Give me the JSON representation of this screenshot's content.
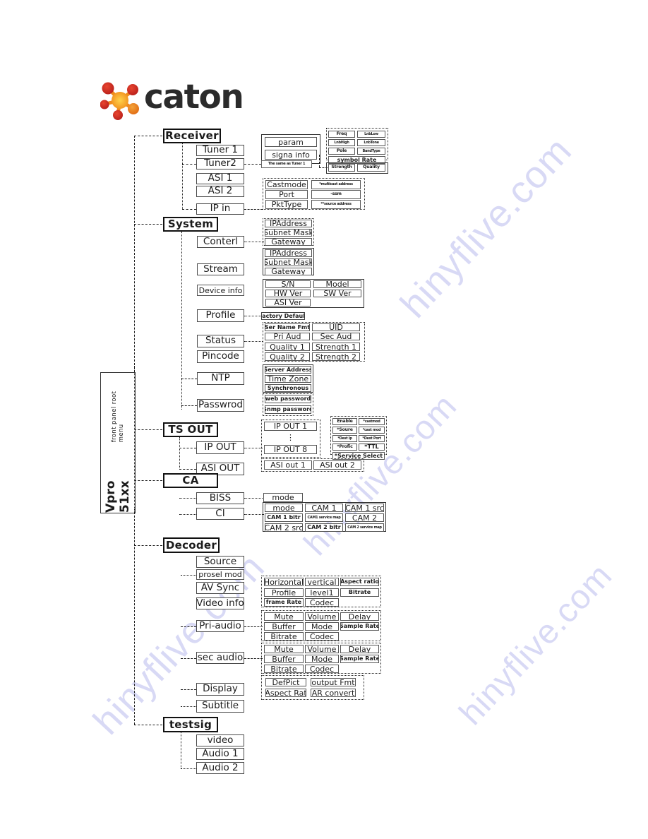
{
  "brand": {
    "name": "caton",
    "logo_icon": "caton-molecule-logo"
  },
  "watermark": {
    "text": "hinyflive.com"
  },
  "root": {
    "title": "Vpro 51xx",
    "subtitle": "front  panel  root  menu"
  },
  "sections": [
    {
      "id": "receiver",
      "title": "Receiver",
      "children": [
        {
          "label": "Tuner 1"
        },
        {
          "label": "Tuner2"
        },
        {
          "label": "ASI 1"
        },
        {
          "label": "ASI 2"
        },
        {
          "label": "IP  in"
        }
      ],
      "detail_groups": [
        {
          "id": "tuner1-detail",
          "items": [
            "param",
            "signa info"
          ]
        },
        {
          "id": "tuner2-detail",
          "items": [
            "The same as Tuner 1"
          ]
        },
        {
          "id": "param-detail",
          "items": [
            "Freq",
            "LnbLow",
            "LnbHigh",
            "LnbTone",
            "Pole",
            "BandType",
            "symbol Rate"
          ]
        },
        {
          "id": "signal-detail",
          "items": [
            "Strength",
            "Quality"
          ]
        },
        {
          "id": "ipin-detail",
          "items": [
            "Castmode",
            "*multicast address",
            "Port",
            "-ssm",
            "PktType",
            "**source address"
          ]
        }
      ]
    },
    {
      "id": "system",
      "title": "System",
      "children": [
        {
          "label": "Conterl"
        },
        {
          "label": "Stream"
        },
        {
          "label": "Device info"
        },
        {
          "label": "Profile"
        },
        {
          "label": "Status"
        },
        {
          "label": "Pincode"
        },
        {
          "label": "NTP"
        },
        {
          "label": "Passwrod"
        }
      ],
      "detail_groups": [
        {
          "id": "conterl-detail",
          "items": [
            "IPAddress",
            "Subnet Mask",
            "Gateway"
          ]
        },
        {
          "id": "stream-detail",
          "items": [
            "IPAddress",
            "Subnet Mask",
            "Gateway"
          ]
        },
        {
          "id": "device-detail",
          "items": [
            "S/N",
            "Model",
            "HW Ver",
            "SW Ver",
            "ASI Ver"
          ]
        },
        {
          "id": "profile-detail",
          "items": [
            "Factory  Default"
          ]
        },
        {
          "id": "status-detail",
          "items": [
            "Ser Name  Fmt",
            "UID",
            "Pri Aud",
            "Sec Aud",
            "Quality 1",
            "Strength 1",
            "Quality 2",
            "Strength 2"
          ]
        },
        {
          "id": "ntp-detail",
          "items": [
            "Server Address",
            "Time Zone",
            "Synchronous"
          ]
        },
        {
          "id": "password-detail",
          "items": [
            "web password",
            "Snmp password"
          ]
        }
      ]
    },
    {
      "id": "tsout",
      "title": "TS OUT",
      "children": [
        {
          "label": "IP OUT"
        },
        {
          "label": "ASI OUT"
        }
      ],
      "detail_groups": [
        {
          "id": "ipout-list",
          "items": [
            "IP OUT    1",
            "⋮",
            "IP OUT   8"
          ]
        },
        {
          "id": "ipout-detail",
          "items": [
            "Enable",
            "*castmod",
            "*Soure",
            "*cast mod",
            "*Dest Ip",
            "*Dest Port",
            "*Profic",
            "*TTL",
            "*Service Select"
          ]
        },
        {
          "id": "asiout-detail",
          "items": [
            "ASI out 1",
            "ASI out 2"
          ]
        }
      ]
    },
    {
      "id": "ca",
      "title": "CA",
      "children": [
        {
          "label": "BISS"
        },
        {
          "label": "CI"
        }
      ],
      "detail_groups": [
        {
          "id": "biss-detail",
          "items": [
            "mode"
          ]
        },
        {
          "id": "ci-detail",
          "items": [
            "mode",
            "CAM 1",
            "CAM 1 src",
            "CAM 1 bitr",
            "CAM1 service map",
            "CAM 2",
            "CAM 2 src",
            "CAM 2 bitr",
            "CAM 2 service map"
          ]
        }
      ]
    },
    {
      "id": "decoder",
      "title": "Decoder",
      "children": [
        {
          "label": "Source"
        },
        {
          "label": "prosel  mod"
        },
        {
          "label": "AV  Sync"
        },
        {
          "label": "Video  info"
        },
        {
          "label": "Pri-audio"
        },
        {
          "label": "sec  audio"
        },
        {
          "label": "Display"
        },
        {
          "label": "Subtitle"
        }
      ],
      "detail_groups": [
        {
          "id": "videoinfo-detail",
          "items": [
            "Horizontal",
            "vertical",
            "Aspect ratio",
            "Profile",
            "level1",
            "Bitrate",
            "frame Rate",
            "Codec"
          ]
        },
        {
          "id": "priaudio-detail",
          "items": [
            "Mute",
            "Volume",
            "Delay",
            "Buffer",
            "Mode",
            "Sample Rate",
            "Bitrate",
            "Codec"
          ]
        },
        {
          "id": "secaudio-detail",
          "items": [
            "Mute",
            "Volume",
            "Delay",
            "Buffer",
            "Mode",
            "Sample Rate",
            "Bitrate",
            "Codec"
          ]
        },
        {
          "id": "display-detail",
          "items": [
            "DefPict",
            "output Fmt",
            "Aspect Rat",
            "AR convert"
          ]
        }
      ]
    },
    {
      "id": "testsig",
      "title": "testsig",
      "children": [
        {
          "label": "video"
        },
        {
          "label": "Audio 1"
        },
        {
          "label": "Audio 2"
        }
      ],
      "detail_groups": []
    }
  ]
}
